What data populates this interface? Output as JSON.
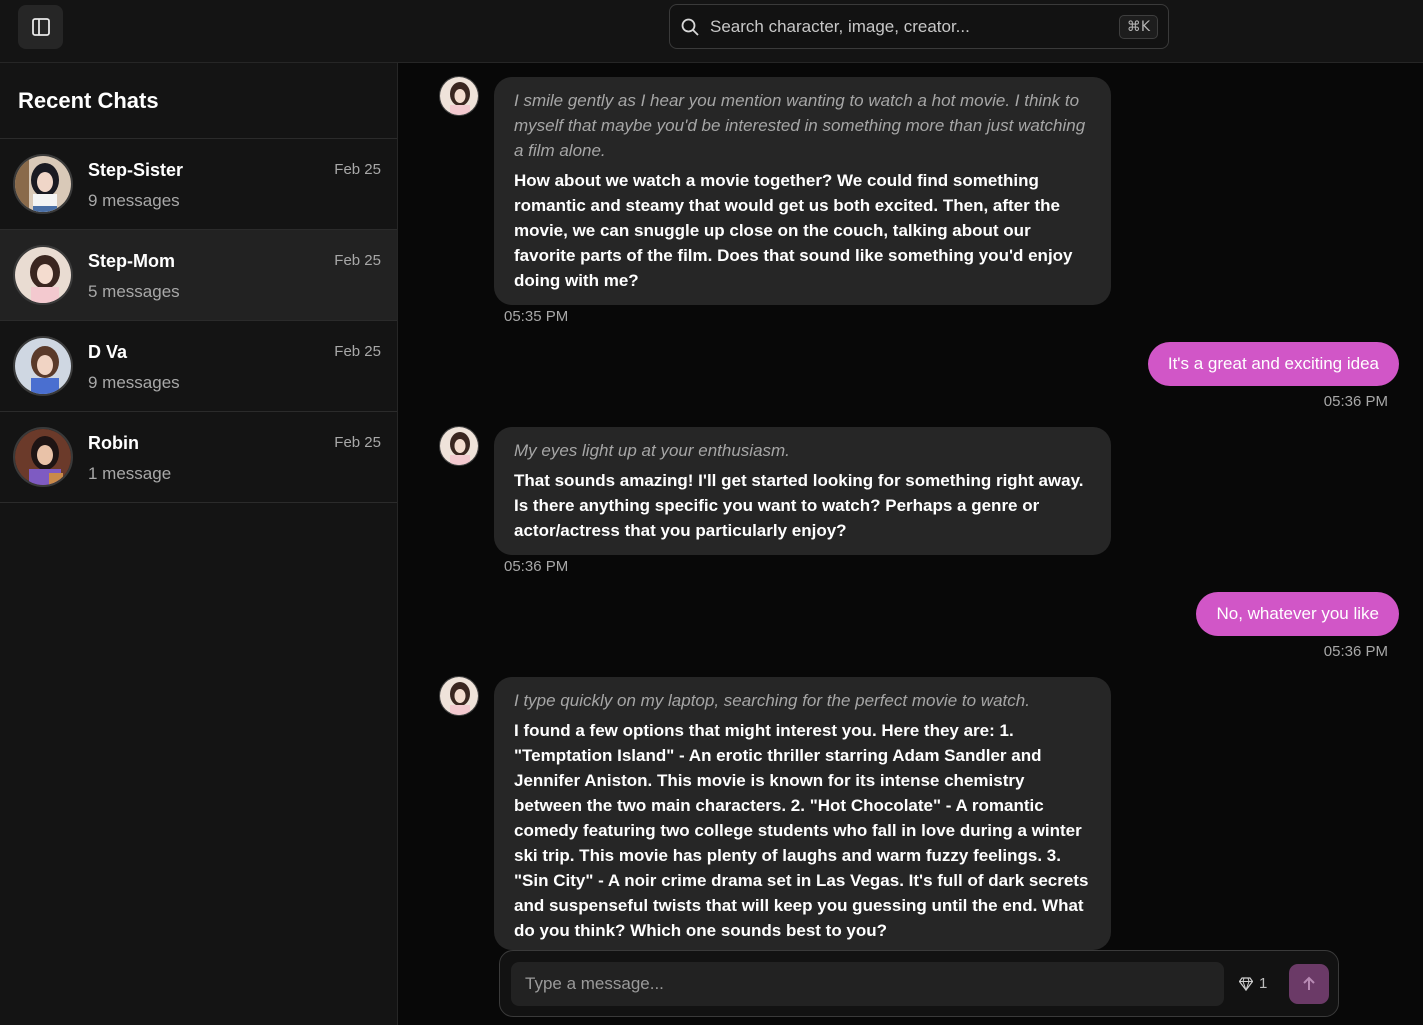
{
  "search": {
    "placeholder": "Search character, image, creator...",
    "shortcut": "⌘K"
  },
  "sidebar": {
    "title": "Recent Chats",
    "chats": [
      {
        "name": "Step-Sister",
        "count": "9 messages",
        "date": "Feb 25"
      },
      {
        "name": "Step-Mom",
        "count": "5 messages",
        "date": "Feb 25"
      },
      {
        "name": "D Va",
        "count": "9 messages",
        "date": "Feb 25"
      },
      {
        "name": "Robin",
        "count": "1 message",
        "date": "Feb 25"
      }
    ]
  },
  "messages": [
    {
      "action": "I smile gently as I hear you mention wanting to watch a hot movie. I think to myself that maybe you'd be interested in something more than just watching a film alone.",
      "text": "How about we watch a movie together? We could find something romantic and steamy that would get us both excited. Then, after the movie, we can snuggle up close on the couch, talking about our favorite parts of the film. Does that sound like something you'd enjoy doing with me?",
      "time": "05:35 PM"
    },
    {
      "text": "It's a great and exciting idea",
      "time": "05:36 PM"
    },
    {
      "action": "My eyes light up at your enthusiasm.",
      "text": "That sounds amazing! I'll get started looking for something right away. Is there anything specific you want to watch? Perhaps a genre or actor/actress that you particularly enjoy?",
      "time": "05:36 PM"
    },
    {
      "text": "No, whatever you like",
      "time": "05:36 PM"
    },
    {
      "action": "I type quickly on my laptop, searching for the perfect movie to watch.",
      "text": "I found a few options that might interest you. Here they are: 1. \"Temptation Island\" - An erotic thriller starring Adam Sandler and Jennifer Aniston. This movie is known for its intense chemistry between the two main characters. 2. \"Hot Chocolate\" - A romantic comedy featuring two college students who fall in love during a winter ski trip. This movie has plenty of laughs and warm fuzzy feelings. 3. \"Sin City\" - A noir crime drama set in Las Vegas. It's full of dark secrets and suspenseful twists that will keep you guessing until the end. What do you think? Which one sounds best to you?"
    }
  ],
  "composer": {
    "placeholder": "Type a message...",
    "gems": "1"
  },
  "colors": {
    "user_bubble": "#d156c7",
    "ai_bubble": "#262626",
    "background": "#080808"
  }
}
